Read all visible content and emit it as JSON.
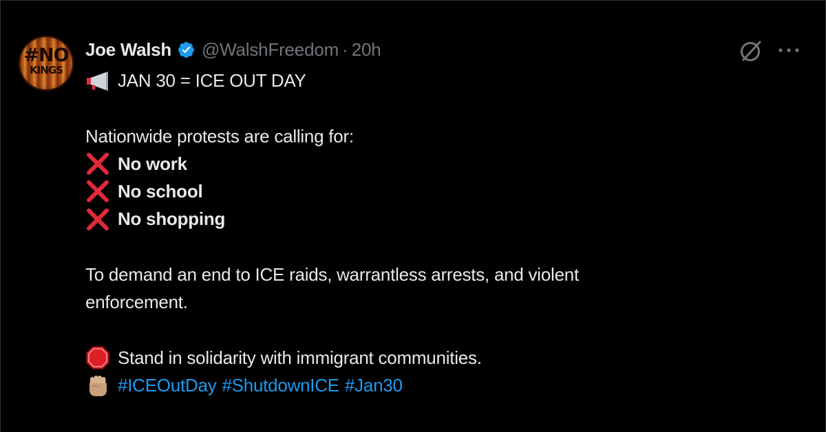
{
  "post": {
    "author": {
      "name": "Joe Walsh",
      "handle": "@WalshFreedom",
      "verified": true,
      "avatar_text_line1": "#NO",
      "avatar_text_line2": "KINGS"
    },
    "separator": "·",
    "time_ago": "20h",
    "headline": "JAN 30 = ICE OUT DAY",
    "intro": "Nationwide protests are calling for:",
    "demands": [
      "No work",
      "No school",
      "No shopping"
    ],
    "purpose_line1": "To demand an end to ICE raids, warrantless arrests, and violent",
    "purpose_line2": "enforcement.",
    "solidarity": "Stand in solidarity with immigrant communities.",
    "hashtags": [
      "#ICEOutDay",
      "#ShutdownICE",
      "#Jan30"
    ]
  },
  "icons": {
    "headline": "megaphone-icon",
    "demand": "cross-mark-icon",
    "solidarity": "stop-sign-icon",
    "hashtags": "raised-fist-icon",
    "verified": "verified-badge-icon",
    "grok": "grok-icon",
    "more": "more-options-icon"
  },
  "colors": {
    "background": "#000000",
    "text": "#e7e9ea",
    "muted": "#71767b",
    "link": "#1d9bf0",
    "verified": "#1d9bf0",
    "cross": "#e2293a",
    "stop": "#dc1f26"
  }
}
